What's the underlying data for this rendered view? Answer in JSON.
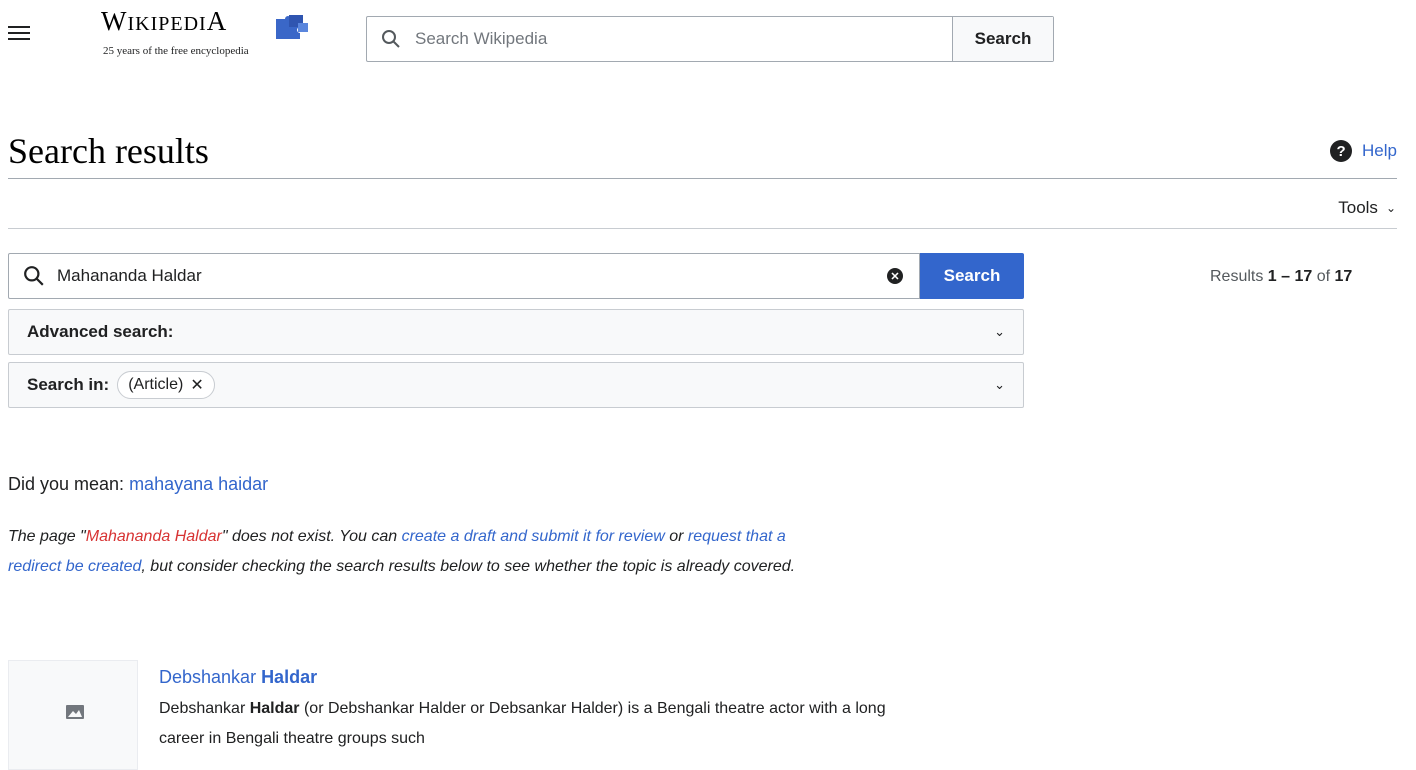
{
  "header": {
    "logo_word_big": "W",
    "logo_word_rest": "IKIPEDI",
    "logo_word_last": "A",
    "tagline": "25 years of the free encyclopedia",
    "search_placeholder": "Search Wikipedia",
    "search_button": "Search"
  },
  "page": {
    "title": "Search results",
    "help_label": "Help",
    "tools_label": "Tools"
  },
  "search": {
    "query": "Mahananda Haldar",
    "button": "Search",
    "results_prefix": "Results ",
    "results_range": "1 – 17",
    "results_of": " of ",
    "results_total": "17",
    "advanced_label": "Advanced search:",
    "search_in_label": "Search in:",
    "chip_label": "(Article)"
  },
  "suggestion": {
    "prefix": "Did you mean: ",
    "link": "mahayana haidar"
  },
  "notice": {
    "t1": "The page \"",
    "missing_page": "Mahananda Haldar",
    "t2": "\" does not exist. You can ",
    "link1": "create a draft and submit it for review",
    "t3": " or ",
    "link2": "request that a redirect be created",
    "t4": ", but consider checking the search results below to see whether the topic is already covered."
  },
  "results": [
    {
      "title_plain": "Debshankar ",
      "title_bold": "Haldar",
      "snippet_a": "Debshankar ",
      "snippet_bold": "Haldar",
      "snippet_b": " (or Debshankar Halder or Debsankar Halder) is a Bengali theatre actor with a long career in Bengali theatre groups such"
    }
  ],
  "icons": {
    "menu": "hamburger-icon",
    "search": "magnifier-icon",
    "clear": "clear-circle-icon",
    "help": "question-circle-icon",
    "chevron": "chevron-down-icon",
    "chip_remove": "close-icon",
    "thumbnail": "image-placeholder-icon"
  },
  "colors": {
    "link": "#3366cc",
    "redlink": "#d73333",
    "primary_button": "#3366cc"
  }
}
